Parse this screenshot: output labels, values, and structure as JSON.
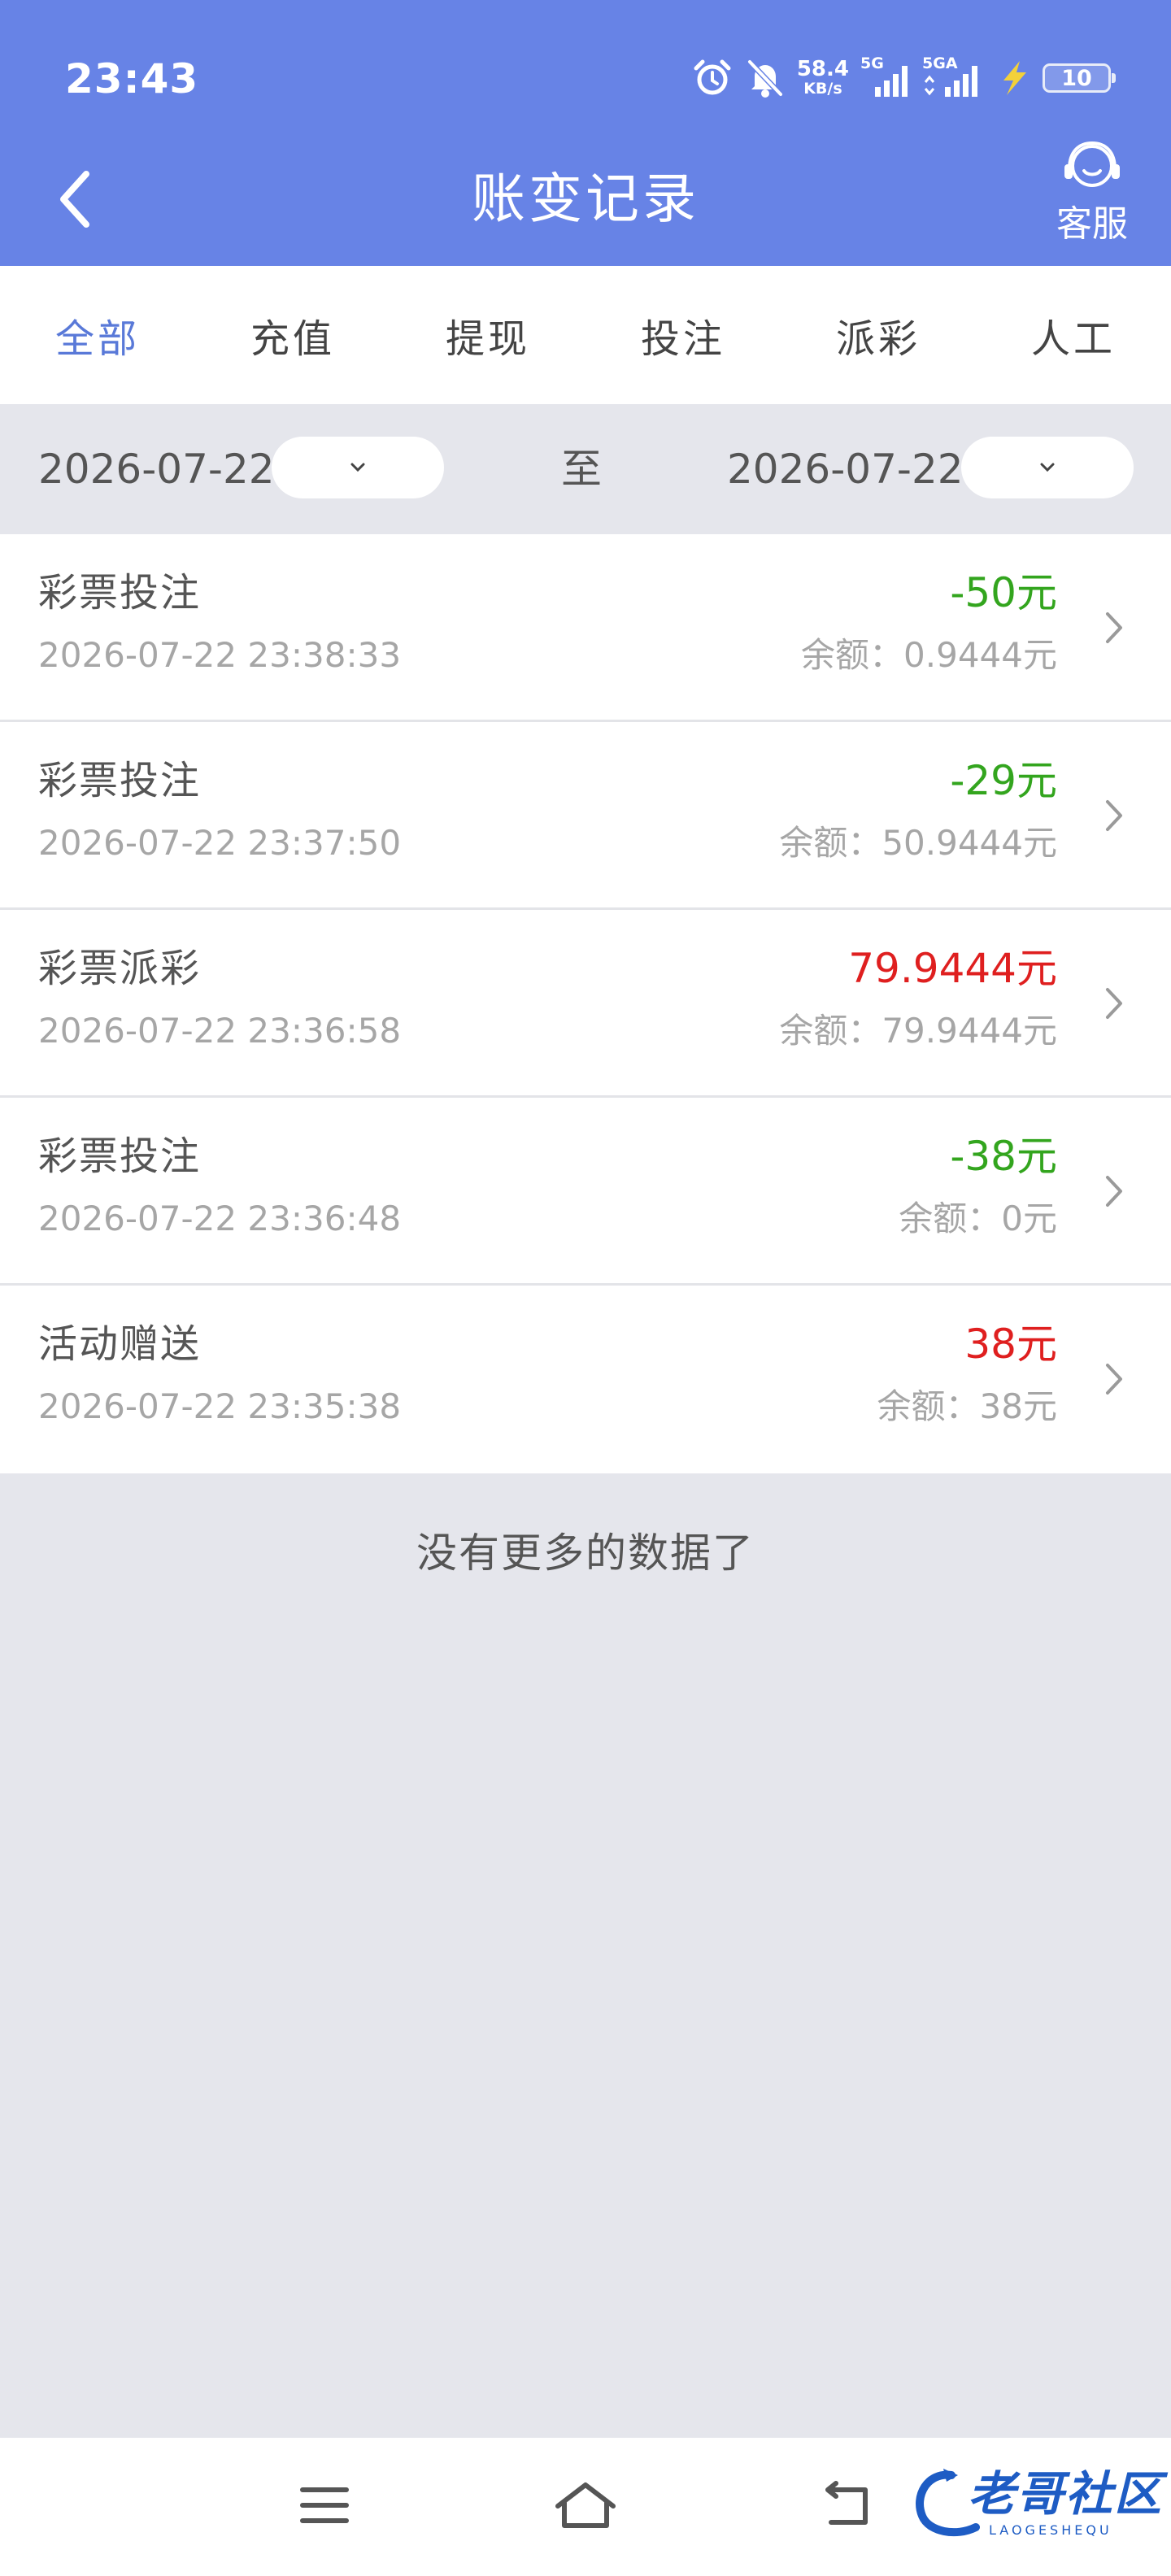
{
  "status_bar": {
    "time": "23:43",
    "net_speed": "58.4",
    "net_unit": "KB/s",
    "sim1": "5G",
    "sim2": "5GA",
    "battery": "10"
  },
  "nav": {
    "title": "账变记录",
    "service_label": "客服"
  },
  "tabs": [
    {
      "label": "全部",
      "active": true
    },
    {
      "label": "充值",
      "active": false
    },
    {
      "label": "提现",
      "active": false
    },
    {
      "label": "投注",
      "active": false
    },
    {
      "label": "派彩",
      "active": false
    },
    {
      "label": "人工",
      "active": false
    }
  ],
  "date_filter": {
    "start": "2026-07-22",
    "separator": "至",
    "end": "2026-07-22"
  },
  "records": [
    {
      "type": "彩票投注",
      "time": "2026-07-22 23:38:33",
      "amount": "-50元",
      "sign": "neg",
      "balance": "余额：0.9444元"
    },
    {
      "type": "彩票投注",
      "time": "2026-07-22 23:37:50",
      "amount": "-29元",
      "sign": "neg",
      "balance": "余额：50.9444元"
    },
    {
      "type": "彩票派彩",
      "time": "2026-07-22 23:36:58",
      "amount": "79.9444元",
      "sign": "pos",
      "balance": "余额：79.9444元"
    },
    {
      "type": "彩票投注",
      "time": "2026-07-22 23:36:48",
      "amount": "-38元",
      "sign": "neg",
      "balance": "余额：0元"
    },
    {
      "type": "活动赠送",
      "time": "2026-07-22 23:35:38",
      "amount": "38元",
      "sign": "pos",
      "balance": "余额：38元"
    }
  ],
  "end_text": "没有更多的数据了",
  "watermark": {
    "text": "老哥社区",
    "sub": "LAOGESHEQU"
  },
  "colors": {
    "header_bg": "#6783e6",
    "active_tab": "#5979d8",
    "negative_amount": "#33a51e",
    "positive_amount": "#df1f1f",
    "page_bg": "#e5e6ec"
  },
  "icons": {
    "status": [
      "alarm-icon",
      "bell-off-icon",
      "signal-icon",
      "signal-icon",
      "charging-icon",
      "battery-icon"
    ],
    "nav": [
      "back-arrow-icon",
      "headset-icon"
    ],
    "row": "chevron-right-icon",
    "date": "chevron-down-icon",
    "navbar": [
      "menu-icon",
      "home-icon",
      "back-icon"
    ]
  }
}
